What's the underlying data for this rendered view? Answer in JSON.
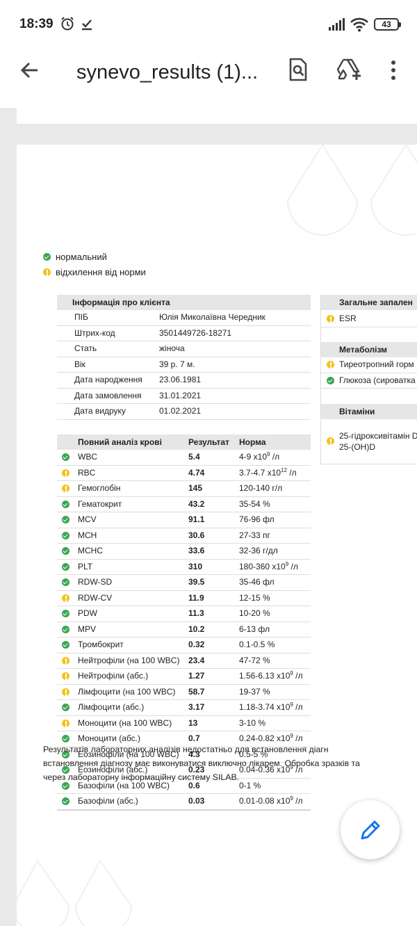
{
  "status": {
    "time": "18:39",
    "battery": "43"
  },
  "appbar": {
    "title": "synevo_results (1)..."
  },
  "legend": {
    "normal": "нормальний",
    "deviation": "відхилення від норми"
  },
  "client": {
    "header": "Інформація про клієнта",
    "rows": [
      {
        "label": "ПІБ",
        "value": "Юлія Миколаївна Чередник"
      },
      {
        "label": "Штрих-код",
        "value": "3501449726-18271"
      },
      {
        "label": "Стать",
        "value": "жіноча"
      },
      {
        "label": "Вік",
        "value": "39 р. 7 м."
      },
      {
        "label": "Дата народження",
        "value": "23.06.1981"
      },
      {
        "label": "Дата замовлення",
        "value": "31.01.2021"
      },
      {
        "label": "Дата видруку",
        "value": "01.02.2021"
      }
    ]
  },
  "blood": {
    "header": "Повний аналіз крові",
    "col_result": "Результат",
    "col_norm": "Норма",
    "rows": [
      {
        "status": "ok",
        "name": "WBC",
        "result": "5.4",
        "norm": "4-9 x10",
        "sup": "9",
        "unit": " /л"
      },
      {
        "status": "warn",
        "name": "RBC",
        "result": "4.74",
        "norm": "3.7-4.7 x10",
        "sup": "12",
        "unit": " /л"
      },
      {
        "status": "warn",
        "name": "Гемоглобін",
        "result": "145",
        "norm": "120-140 г/л",
        "sup": "",
        "unit": ""
      },
      {
        "status": "ok",
        "name": "Гематокрит",
        "result": "43.2",
        "norm": "35-54 %",
        "sup": "",
        "unit": ""
      },
      {
        "status": "ok",
        "name": "MCV",
        "result": "91.1",
        "norm": "76-96 фл",
        "sup": "",
        "unit": ""
      },
      {
        "status": "ok",
        "name": "MCH",
        "result": "30.6",
        "norm": "27-33 пг",
        "sup": "",
        "unit": ""
      },
      {
        "status": "ok",
        "name": "MCHC",
        "result": "33.6",
        "norm": "32-36 г/дл",
        "sup": "",
        "unit": ""
      },
      {
        "status": "ok",
        "name": "PLT",
        "result": "310",
        "norm": "180-360 x10",
        "sup": "9",
        "unit": " /л"
      },
      {
        "status": "ok",
        "name": "RDW-SD",
        "result": "39.5",
        "norm": "35-46 фл",
        "sup": "",
        "unit": ""
      },
      {
        "status": "warn",
        "name": "RDW-CV",
        "result": "11.9",
        "norm": "12-15 %",
        "sup": "",
        "unit": ""
      },
      {
        "status": "ok",
        "name": "PDW",
        "result": "11.3",
        "norm": "10-20 %",
        "sup": "",
        "unit": ""
      },
      {
        "status": "ok",
        "name": "MPV",
        "result": "10.2",
        "norm": "6-13 фл",
        "sup": "",
        "unit": ""
      },
      {
        "status": "ok",
        "name": "Тромбокрит",
        "result": "0.32",
        "norm": "0.1-0.5 %",
        "sup": "",
        "unit": ""
      },
      {
        "status": "warn",
        "name": "Нейтрофіли (на 100 WBC)",
        "result": "23.4",
        "norm": "47-72 %",
        "sup": "",
        "unit": ""
      },
      {
        "status": "warn",
        "name": "Нейтрофіли (абс.)",
        "result": "1.27",
        "norm": "1.56-6.13 x10",
        "sup": "9",
        "unit": " /л"
      },
      {
        "status": "warn",
        "name": "Лімфоцити (на 100 WBC)",
        "result": "58.7",
        "norm": "19-37 %",
        "sup": "",
        "unit": ""
      },
      {
        "status": "ok",
        "name": "Лімфоцити (абс.)",
        "result": "3.17",
        "norm": "1.18-3.74 x10",
        "sup": "9",
        "unit": " /л"
      },
      {
        "status": "warn",
        "name": "Моноцити (на 100 WBC)",
        "result": "13",
        "norm": "3-10 %",
        "sup": "",
        "unit": ""
      },
      {
        "status": "ok",
        "name": "Моноцити (абс.)",
        "result": "0.7",
        "norm": "0.24-0.82 x10",
        "sup": "9",
        "unit": " /л"
      },
      {
        "status": "ok",
        "name": "Еозинофіли (на 100 WBC)",
        "result": "4.3",
        "norm": "0.5-5 %",
        "sup": "",
        "unit": ""
      },
      {
        "status": "ok",
        "name": "Еозинофіли (абс.)",
        "result": "0.23",
        "norm": "0.04-0.36 x10",
        "sup": "9",
        "unit": " /л"
      },
      {
        "status": "ok",
        "name": "Базофіли (на 100 WBC)",
        "result": "0.6",
        "norm": "0-1 %",
        "sup": "",
        "unit": ""
      },
      {
        "status": "ok",
        "name": "Базофіли (абс.)",
        "result": "0.03",
        "norm": "0.01-0.08 x10",
        "sup": "9",
        "unit": " /л"
      }
    ]
  },
  "right": {
    "inflammation_header": "Загальне запален",
    "esr": "ESR",
    "metabolism_header": "Метаболізм",
    "tsh": "Тиреотропний горм",
    "glucose": "Глюкоза (сироватка",
    "vitamins_header": "Вітаміни",
    "vitd_line1": "25-гідроксивітамін D",
    "vitd_line2": "25-(OH)D"
  },
  "footer": {
    "line1_a": "Результатів",
    "line1_b": "лабораторних аналізів недостатньо для встановлення діагн",
    "line2": "встановлення діагнозу має виконуватися виключно лікарем. Обробка зразків та",
    "line3": "через лабораторну інформаційну систему SILAB."
  }
}
